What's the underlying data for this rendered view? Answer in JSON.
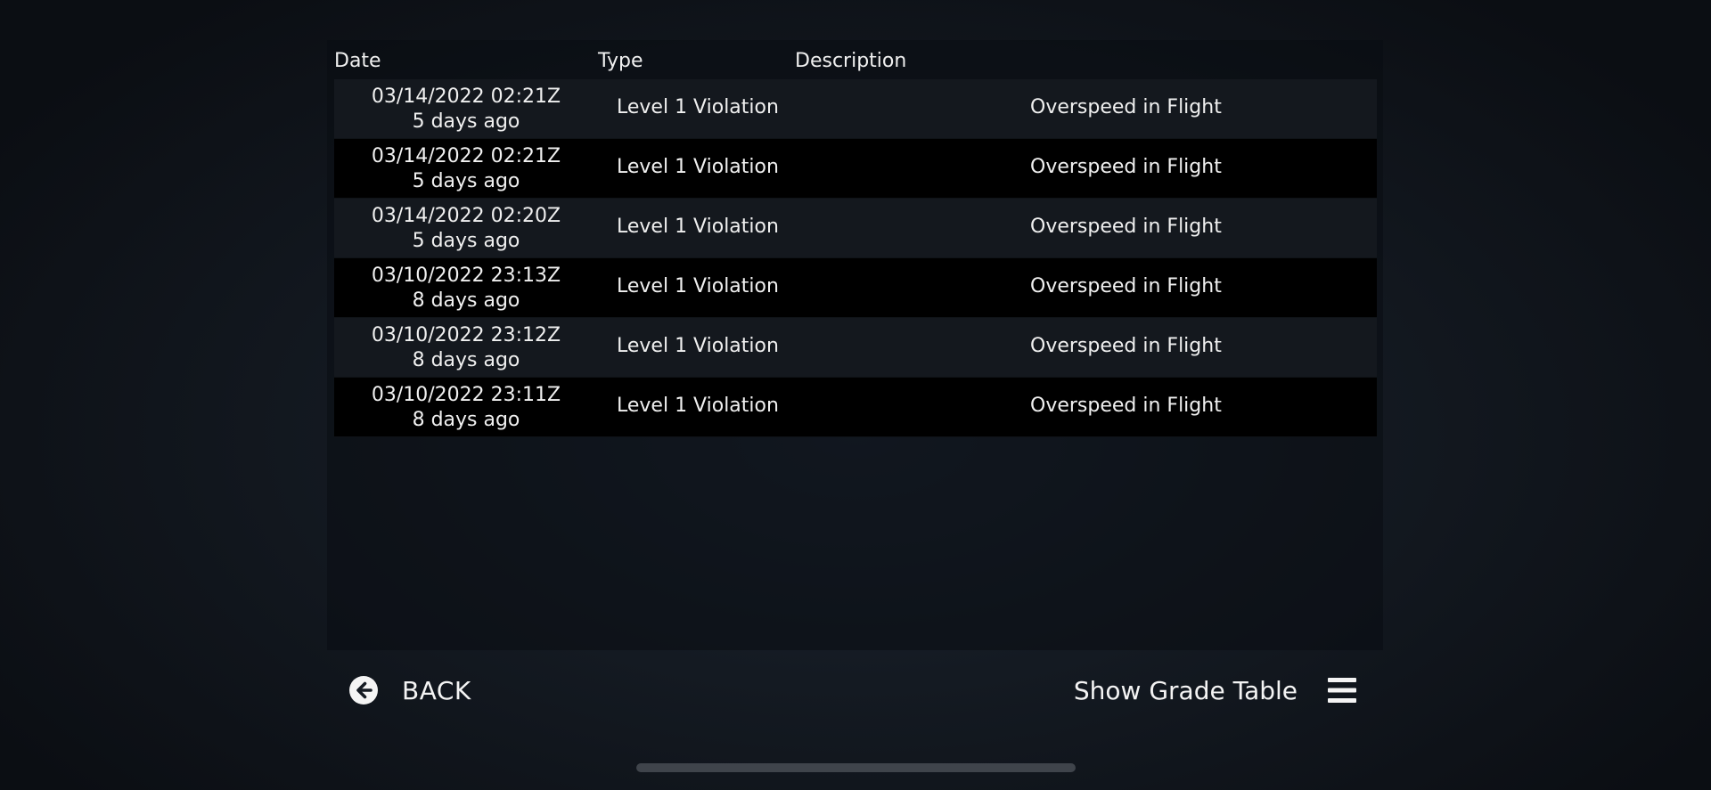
{
  "table": {
    "headers": {
      "date": "Date",
      "type": "Type",
      "description": "Description"
    },
    "rows": [
      {
        "date": "03/14/2022 02:21Z",
        "relative": "5 days ago",
        "type": "Level 1 Violation",
        "description": "Overspeed in Flight"
      },
      {
        "date": "03/14/2022 02:21Z",
        "relative": "5 days ago",
        "type": "Level 1 Violation",
        "description": "Overspeed in Flight"
      },
      {
        "date": "03/14/2022 02:20Z",
        "relative": "5 days ago",
        "type": "Level 1 Violation",
        "description": "Overspeed in Flight"
      },
      {
        "date": "03/10/2022 23:13Z",
        "relative": "8 days ago",
        "type": "Level 1 Violation",
        "description": "Overspeed in Flight"
      },
      {
        "date": "03/10/2022 23:12Z",
        "relative": "8 days ago",
        "type": "Level 1 Violation",
        "description": "Overspeed in Flight"
      },
      {
        "date": "03/10/2022 23:11Z",
        "relative": "8 days ago",
        "type": "Level 1 Violation",
        "description": "Overspeed in Flight"
      }
    ]
  },
  "footer": {
    "back_label": "BACK",
    "back_icon": "arrow-left-circle-icon",
    "grade_table_label": "Show Grade Table",
    "grade_table_icon": "hamburger-menu-icon"
  },
  "colors": {
    "row_odd": "#14181e",
    "row_even": "#000000",
    "text": "#f0f0f0",
    "home_indicator": "#3f444b"
  }
}
